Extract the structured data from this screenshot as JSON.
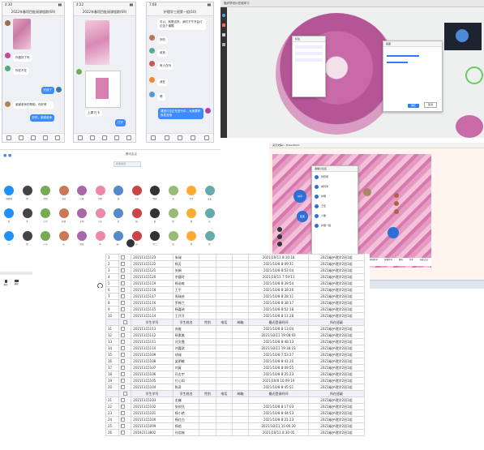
{
  "phones": [
    {
      "time": "4:30",
      "title": "2022年春项目批阅课程群(69)",
      "messages": [
        "你做好了吗",
        "你在不在",
        "完成了",
        "老师你好",
        "谢谢老师的帮助，你好呀",
        "好的，谢谢老师"
      ]
    },
    {
      "time": "4:22",
      "title": "2022年春项目批阅课程群(69)",
      "messages": [
        "上课 打卡",
        "打开"
      ]
    },
    {
      "time": "7:08",
      "title": "护理学三班第一组(10)",
      "messages": [
        "可以，就是这样，我们下午开会讨论这个课题",
        "好的",
        "收到",
        "有人在吗",
        "嗯",
        "我在",
        "课堂讨论正在进行中，大家要积极发言哦"
      ]
    }
  ],
  "viewer": {
    "tab_title": "组织学切片在线学习",
    "dialog1_title": "标注",
    "dialog2_title": "截图",
    "confirm_label": "确定",
    "cancel_label": "取消"
  },
  "meeting": {
    "title": "腾讯会议",
    "search_placeholder": "搜索成员",
    "participants": [
      "张晓雨",
      "胡",
      "李思",
      "王佳",
      "小雅",
      "刘明",
      "张",
      "小贝",
      "晴天",
      "王",
      "主持",
      "安安",
      "陈",
      "李",
      "小宇",
      "护理",
      "王明",
      "小七",
      "花",
      "杨",
      "晨",
      "林",
      "雨",
      "乐",
      "小",
      "周",
      "小王",
      "吴",
      "思思",
      "孙",
      "张一",
      "赵",
      "李二",
      "钱",
      "夏",
      "徐"
    ],
    "mic_label": "静音",
    "camera_label": "视频"
  },
  "slide": {
    "window_title": "演示文稿1 - PowerPoint",
    "chat_title": "课堂讨论区",
    "labels": [
      "共享",
      "结束"
    ],
    "chat_items": [
      "张晓雨",
      "胡同学",
      "刘明",
      "王佳",
      "小雅",
      "护理一组"
    ],
    "tools": [
      "开始共享",
      "屏幕共享",
      "聊天",
      "举手",
      "结束会议"
    ]
  },
  "table": {
    "headers": [
      "学生学号",
      "学生姓名",
      "性别",
      "电话",
      "邮箱",
      "最近登录时间",
      "所在班级"
    ],
    "rows": [
      [
        "1",
        "20211115123",
        "朱瑞",
        "",
        "",
        "",
        "2021/10/11 8:10:18",
        "2021级护理学2班1组"
      ],
      [
        "2",
        "20211115122",
        "杨芳",
        "",
        "",
        "",
        "2021/10/8 8:09:31",
        "2021级护理学2班1组"
      ],
      [
        "3",
        "20211115121",
        "张娟",
        "",
        "",
        "",
        "2021/10/8 8:53:04",
        "2021级护理学2班1组"
      ],
      [
        "4",
        "20211115120",
        "余婕玲",
        "",
        "",
        "",
        "2021/10/11 7:59:11",
        "2021级护理学2班1组"
      ],
      [
        "5",
        "20211115119",
        "杨溢唯",
        "",
        "",
        "",
        "2021/10/8 8:39:54",
        "2021级护理学2班1组"
      ],
      [
        "6",
        "20211115118",
        "王平",
        "",
        "",
        "",
        "2021/10/8 8:38:26",
        "2021级护理学2班1组"
      ],
      [
        "7",
        "20211115117",
        "周瑞芸",
        "",
        "",
        "",
        "2021/10/8 8:28:11",
        "2021级护理学2班1组"
      ],
      [
        "8",
        "20211115116",
        "罗梅兰",
        "",
        "",
        "",
        "2021/10/8 8:38:17",
        "2021级护理学2班1组"
      ],
      [
        "9",
        "20211115115",
        "杨嘉琦",
        "",
        "",
        "",
        "2021/10/8 8:51:18",
        "2021级护理学2班1组"
      ],
      [
        "10",
        "20211115114",
        "王开开",
        "",
        "",
        "",
        "2021/10/8 8:11:28",
        "2021级护理学2班1组"
      ],
      [
        "11",
        "20211115113",
        "苏维",
        "",
        "",
        "",
        "2021/10/8 8:13:04",
        "2021级护理学2班1组"
      ],
      [
        "12",
        "20211115112",
        "杨素美",
        "",
        "",
        "",
        "2021/10/11 19:08:03",
        "2021级护理学2班1组"
      ],
      [
        "13",
        "20211115111",
        "刘文霞",
        "",
        "",
        "",
        "2021/10/8 8:48:13",
        "2021级护理学2班1组"
      ],
      [
        "14",
        "20211115110",
        "刘嘉琪",
        "",
        "",
        "",
        "2021/10/11 19:38:23",
        "2021级护理学2班1组"
      ],
      [
        "15",
        "20211115109",
        "胡瑞",
        "",
        "",
        "",
        "2021/10/8 7:53:27",
        "2021级护理学2班1组"
      ],
      [
        "16",
        "20211115108",
        "梁明敏",
        "",
        "",
        "",
        "2021/10/8 8:41:20",
        "2021级护理学2班1组"
      ],
      [
        "17",
        "20211115107",
        "刘真",
        "",
        "",
        "",
        "2021/10/8 8:09:55",
        "2021级护理学2班1组"
      ],
      [
        "18",
        "20211115106",
        "孙志宇",
        "",
        "",
        "",
        "2021/10/8 8:25:23",
        "2021级护理学2班1组"
      ],
      [
        "19",
        "20211115105",
        "付心如",
        "",
        "",
        "",
        "2021/10/8 16:09:19",
        "2021级护理学2班1组"
      ],
      [
        "20",
        "20211115104",
        "陈奇",
        "",
        "",
        "",
        "2021/10/8 8:45:51",
        "2021级护理学2班1组"
      ],
      [
        "21",
        "20211115103",
        "金巍",
        "",
        "",
        "",
        "",
        "2021级护理学2班1组"
      ],
      [
        "22",
        "20211115102",
        "张钦钰",
        "",
        "",
        "",
        "2021/10/8 8:17:03",
        "2021级护理学2班1组"
      ],
      [
        "23",
        "20211115101",
        "杨小艳",
        "",
        "",
        "",
        "2021/10/8 8:44:53",
        "2021级护理学2班1组"
      ],
      [
        "24",
        "20211115100",
        "杨红白",
        "",
        "",
        "",
        "2021/10/8 8:21:23",
        "2021级护理学2班1组"
      ],
      [
        "25",
        "20211115099",
        "杨凿",
        "",
        "",
        "",
        "2021/10/11 15:00:20",
        "2021级护理学2班1组"
      ],
      [
        "26",
        "20192113802",
        "孙诣铖",
        "",
        "",
        "",
        "2021/10/11 8:30:05",
        "2021级护理学2班1组"
      ]
    ]
  },
  "colors": {
    "accent": "#2d7df6",
    "tissue_pink": "#c86aa8",
    "chat_blue": "#3d8bff"
  }
}
